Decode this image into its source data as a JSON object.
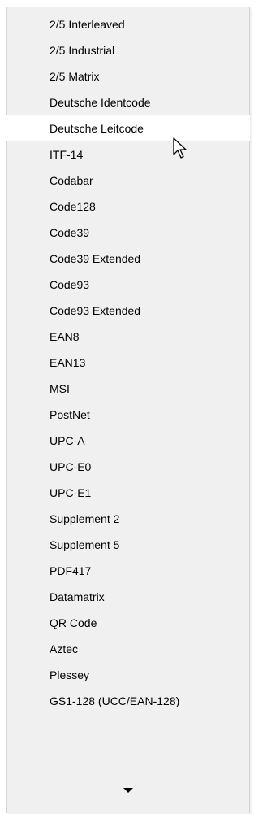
{
  "menu": {
    "items": [
      {
        "label": "2/5 Interleaved"
      },
      {
        "label": "2/5 Industrial"
      },
      {
        "label": "2/5 Matrix"
      },
      {
        "label": "Deutsche Identcode"
      },
      {
        "label": "Deutsche Leitcode",
        "hovered": true
      },
      {
        "label": "ITF-14"
      },
      {
        "label": "Codabar"
      },
      {
        "label": "Code128"
      },
      {
        "label": "Code39"
      },
      {
        "label": "Code39 Extended"
      },
      {
        "label": "Code93"
      },
      {
        "label": "Code93 Extended"
      },
      {
        "label": "EAN8"
      },
      {
        "label": "EAN13"
      },
      {
        "label": "MSI"
      },
      {
        "label": "PostNet"
      },
      {
        "label": "UPC-A"
      },
      {
        "label": "UPC-E0"
      },
      {
        "label": "UPC-E1"
      },
      {
        "label": "Supplement 2"
      },
      {
        "label": "Supplement 5"
      },
      {
        "label": "PDF417"
      },
      {
        "label": "Datamatrix"
      },
      {
        "label": "QR Code"
      },
      {
        "label": "Aztec"
      },
      {
        "label": "Plessey"
      },
      {
        "label": "GS1-128 (UCC/EAN-128)"
      }
    ],
    "scroll_icon": "chevron-down-icon",
    "colors": {
      "menu_background": "#f0f0f0",
      "hover_background": "#ffffff",
      "border": "#d4d4d4",
      "text": "#000000"
    }
  },
  "cursor": {
    "icon": "mouse-pointer-icon"
  }
}
